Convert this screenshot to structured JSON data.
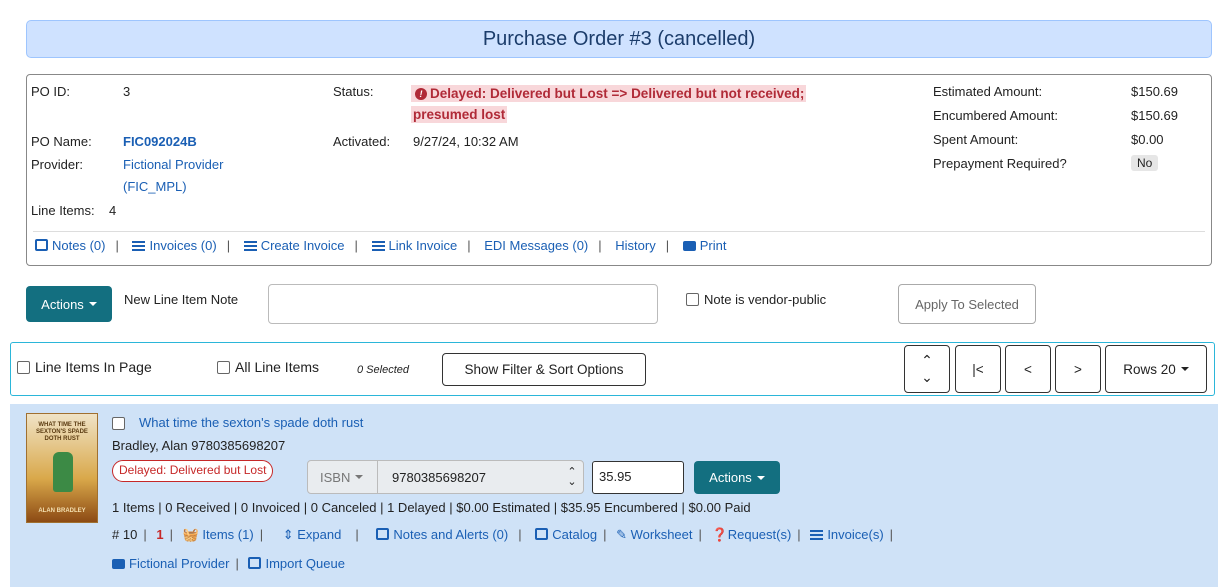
{
  "page": {
    "title": "Purchase Order #3 (cancelled)"
  },
  "summary": {
    "po_id_label": "PO ID:",
    "po_id": "3",
    "po_name_label": "PO Name:",
    "po_name": "FIC092024B",
    "provider_label": "Provider:",
    "provider_line1": "Fictional Provider",
    "provider_line2": "(FIC_MPL)",
    "line_items_label": "Line Items:",
    "line_items": "4",
    "status_label": "Status:",
    "status_line1": "Delayed: Delivered but Lost => Delivered but not received;",
    "status_line2": "presumed lost",
    "activated_label": "Activated:",
    "activated": "9/27/24, 10:32 AM",
    "estimated_label": "Estimated Amount:",
    "estimated": "$150.69",
    "encumbered_label": "Encumbered Amount:",
    "encumbered": "$150.69",
    "spent_label": "Spent Amount:",
    "spent": "$0.00",
    "prepay_label": "Prepayment Required?",
    "prepay": "No",
    "links": {
      "notes": "Notes (0)",
      "invoices": "Invoices (0)",
      "create_invoice": "Create Invoice",
      "link_invoice": "Link Invoice",
      "edi": "EDI Messages (0)",
      "history": "History",
      "print": "Print"
    }
  },
  "toolbar": {
    "actions": "Actions",
    "note_label": "New Line Item Note",
    "vendor_public": "Note is vendor-public",
    "apply": "Apply To Selected"
  },
  "filter": {
    "in_page": "Line Items In Page",
    "all_items": "All Line Items",
    "selected": "0 Selected",
    "show_filter": "Show Filter & Sort Options",
    "rows": "Rows 20"
  },
  "item": {
    "title": "What time the sexton's spade doth rust",
    "author_isbn": "Bradley, Alan 9780385698207",
    "status": "Delayed: Delivered but Lost",
    "ident_type": "ISBN",
    "ident_value": "9780385698207",
    "price": "35.95",
    "actions": "Actions",
    "counts": "1 Items | 0 Received | 0 Invoiced | 0 Canceled | 1 Delayed | $0.00 Estimated | $35.95 Encumbered | $0.00 Paid",
    "number": "# 10",
    "count_red": "1",
    "items_link": "Items (1)",
    "expand": "Expand",
    "notes_alerts": "Notes and Alerts (0)",
    "catalog": "Catalog",
    "worksheet": "Worksheet",
    "requests": "Request(s)",
    "invoices": "Invoice(s)",
    "provider": "Fictional Provider",
    "import_queue": "Import Queue",
    "cover_top": "WHAT TIME THE SEXTON'S SPADE DOTH RUST",
    "cover_author": "ALAN BRADLEY"
  },
  "colors": {
    "accent": "#136f80",
    "title_bg": "#cfe2ff",
    "panel_bg": "#cfe2f7",
    "status_red": "#b02a37"
  }
}
